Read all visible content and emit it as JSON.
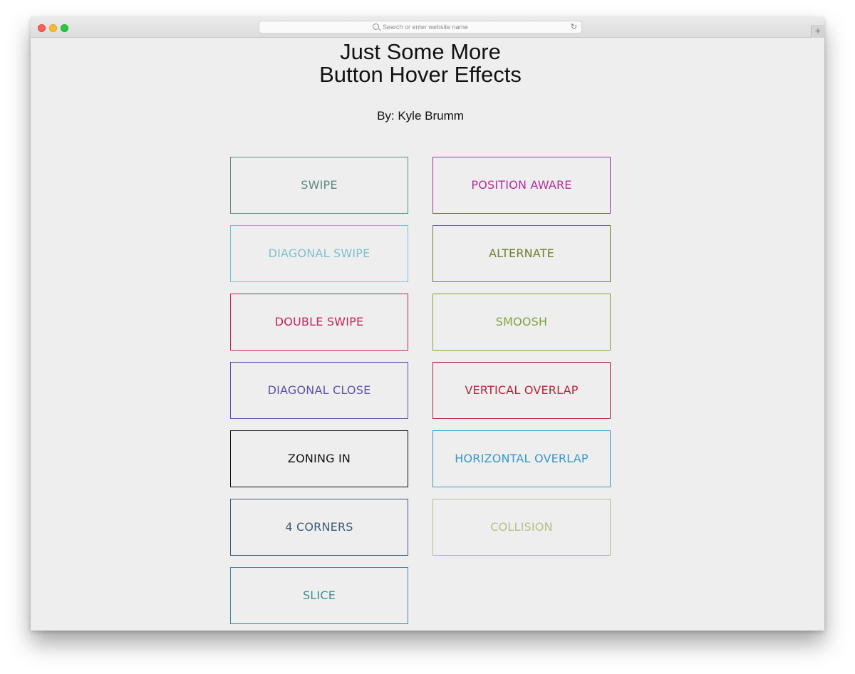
{
  "browser": {
    "url_placeholder": "Search or enter website name",
    "reload_glyph": "↻",
    "newtab_glyph": "+"
  },
  "header": {
    "title_line1": "Just Some More",
    "title_line2": "Button Hover Effects",
    "author": "By: Kyle Brumm"
  },
  "buttons": [
    {
      "label": "SWIPE",
      "color": "#5b8a80"
    },
    {
      "label": "POSITION AWARE",
      "color": "#b32fa1"
    },
    {
      "label": "DIAGONAL SWIPE",
      "color": "#7fbfcc"
    },
    {
      "label": "ALTERNATE",
      "color": "#6e7f34"
    },
    {
      "label": "DOUBLE SWIPE",
      "color": "#c2265a"
    },
    {
      "label": "SMOOSH",
      "color": "#7ea43d"
    },
    {
      "label": "DIAGONAL CLOSE",
      "color": "#6150a8"
    },
    {
      "label": "VERTICAL OVERLAP",
      "color": "#b8223d"
    },
    {
      "label": "ZONING IN",
      "color": "#111111"
    },
    {
      "label": "HORIZONTAL OVERLAP",
      "color": "#3499cc"
    },
    {
      "label": "4 CORNERS",
      "color": "#3e5b75"
    },
    {
      "label": "COLLISION",
      "color": "#b6bf86"
    },
    {
      "label": "SLICE",
      "color": "#3f8b9a"
    }
  ]
}
